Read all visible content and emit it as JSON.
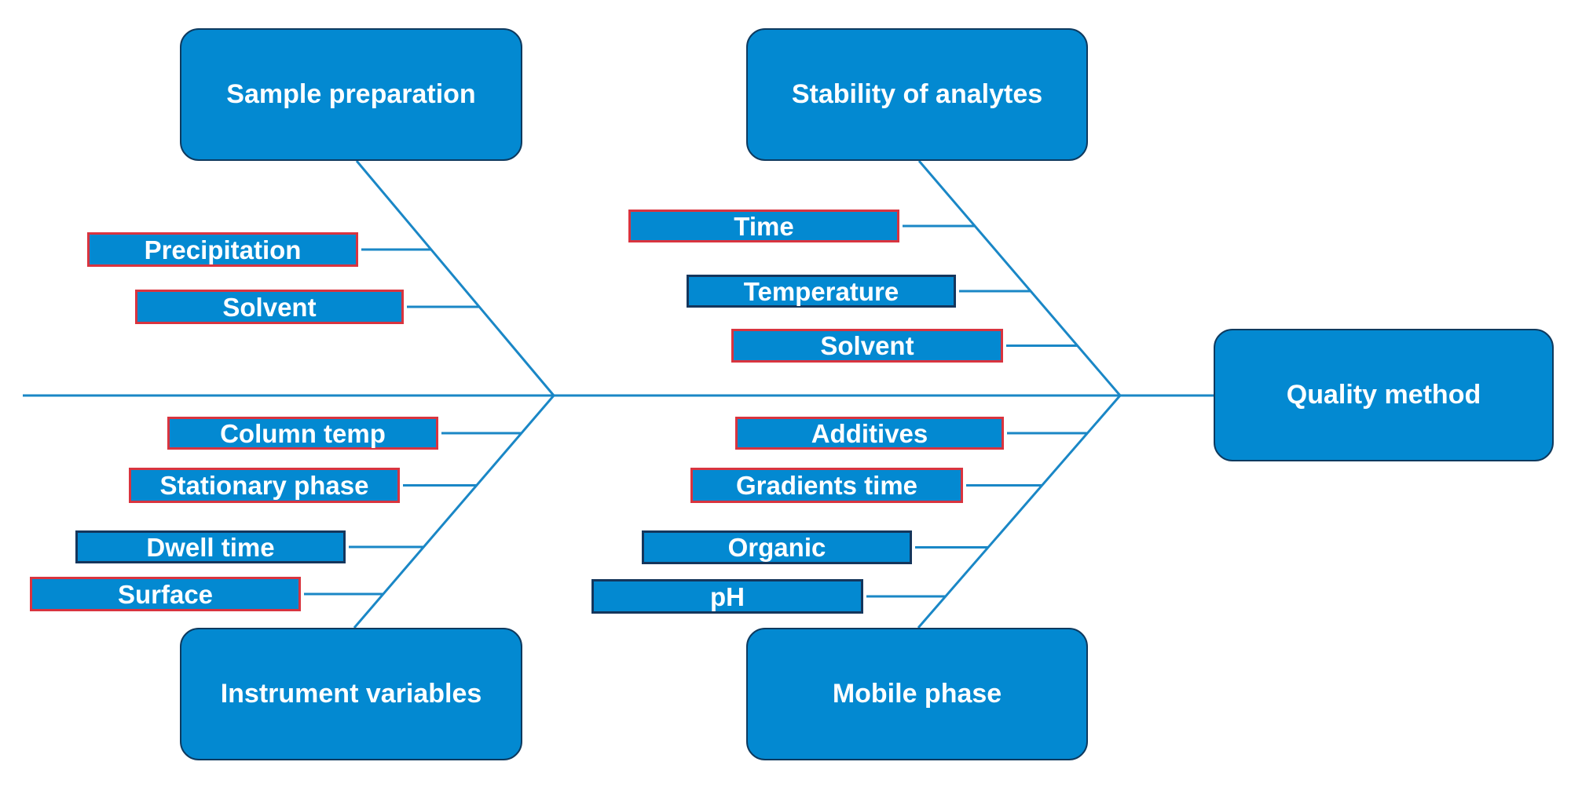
{
  "diagram": {
    "type": "fishbone",
    "effect": "Quality method",
    "colors": {
      "fill": "#0389d1",
      "line": "#1a87c6",
      "category_border": "#0e3a5f",
      "highlight_border": "#d9343f",
      "normal_border": "#15365c",
      "text": "#ffffff"
    },
    "categories": [
      {
        "label": "Sample preparation",
        "causes": [
          {
            "label": "Precipitation",
            "highlighted": true
          },
          {
            "label": "Solvent",
            "highlighted": true
          }
        ]
      },
      {
        "label": "Stability of analytes",
        "causes": [
          {
            "label": "Time",
            "highlighted": true
          },
          {
            "label": "Temperature",
            "highlighted": false
          },
          {
            "label": "Solvent",
            "highlighted": true
          }
        ]
      },
      {
        "label": "Instrument variables",
        "causes": [
          {
            "label": "Column temp",
            "highlighted": true
          },
          {
            "label": "Stationary phase",
            "highlighted": true
          },
          {
            "label": "Dwell time",
            "highlighted": false
          },
          {
            "label": "Surface",
            "highlighted": true
          }
        ]
      },
      {
        "label": "Mobile phase",
        "causes": [
          {
            "label": "Additives",
            "highlighted": true
          },
          {
            "label": "Gradients time",
            "highlighted": true
          },
          {
            "label": "Organic",
            "highlighted": false
          },
          {
            "label": "pH",
            "highlighted": false
          }
        ]
      }
    ]
  }
}
